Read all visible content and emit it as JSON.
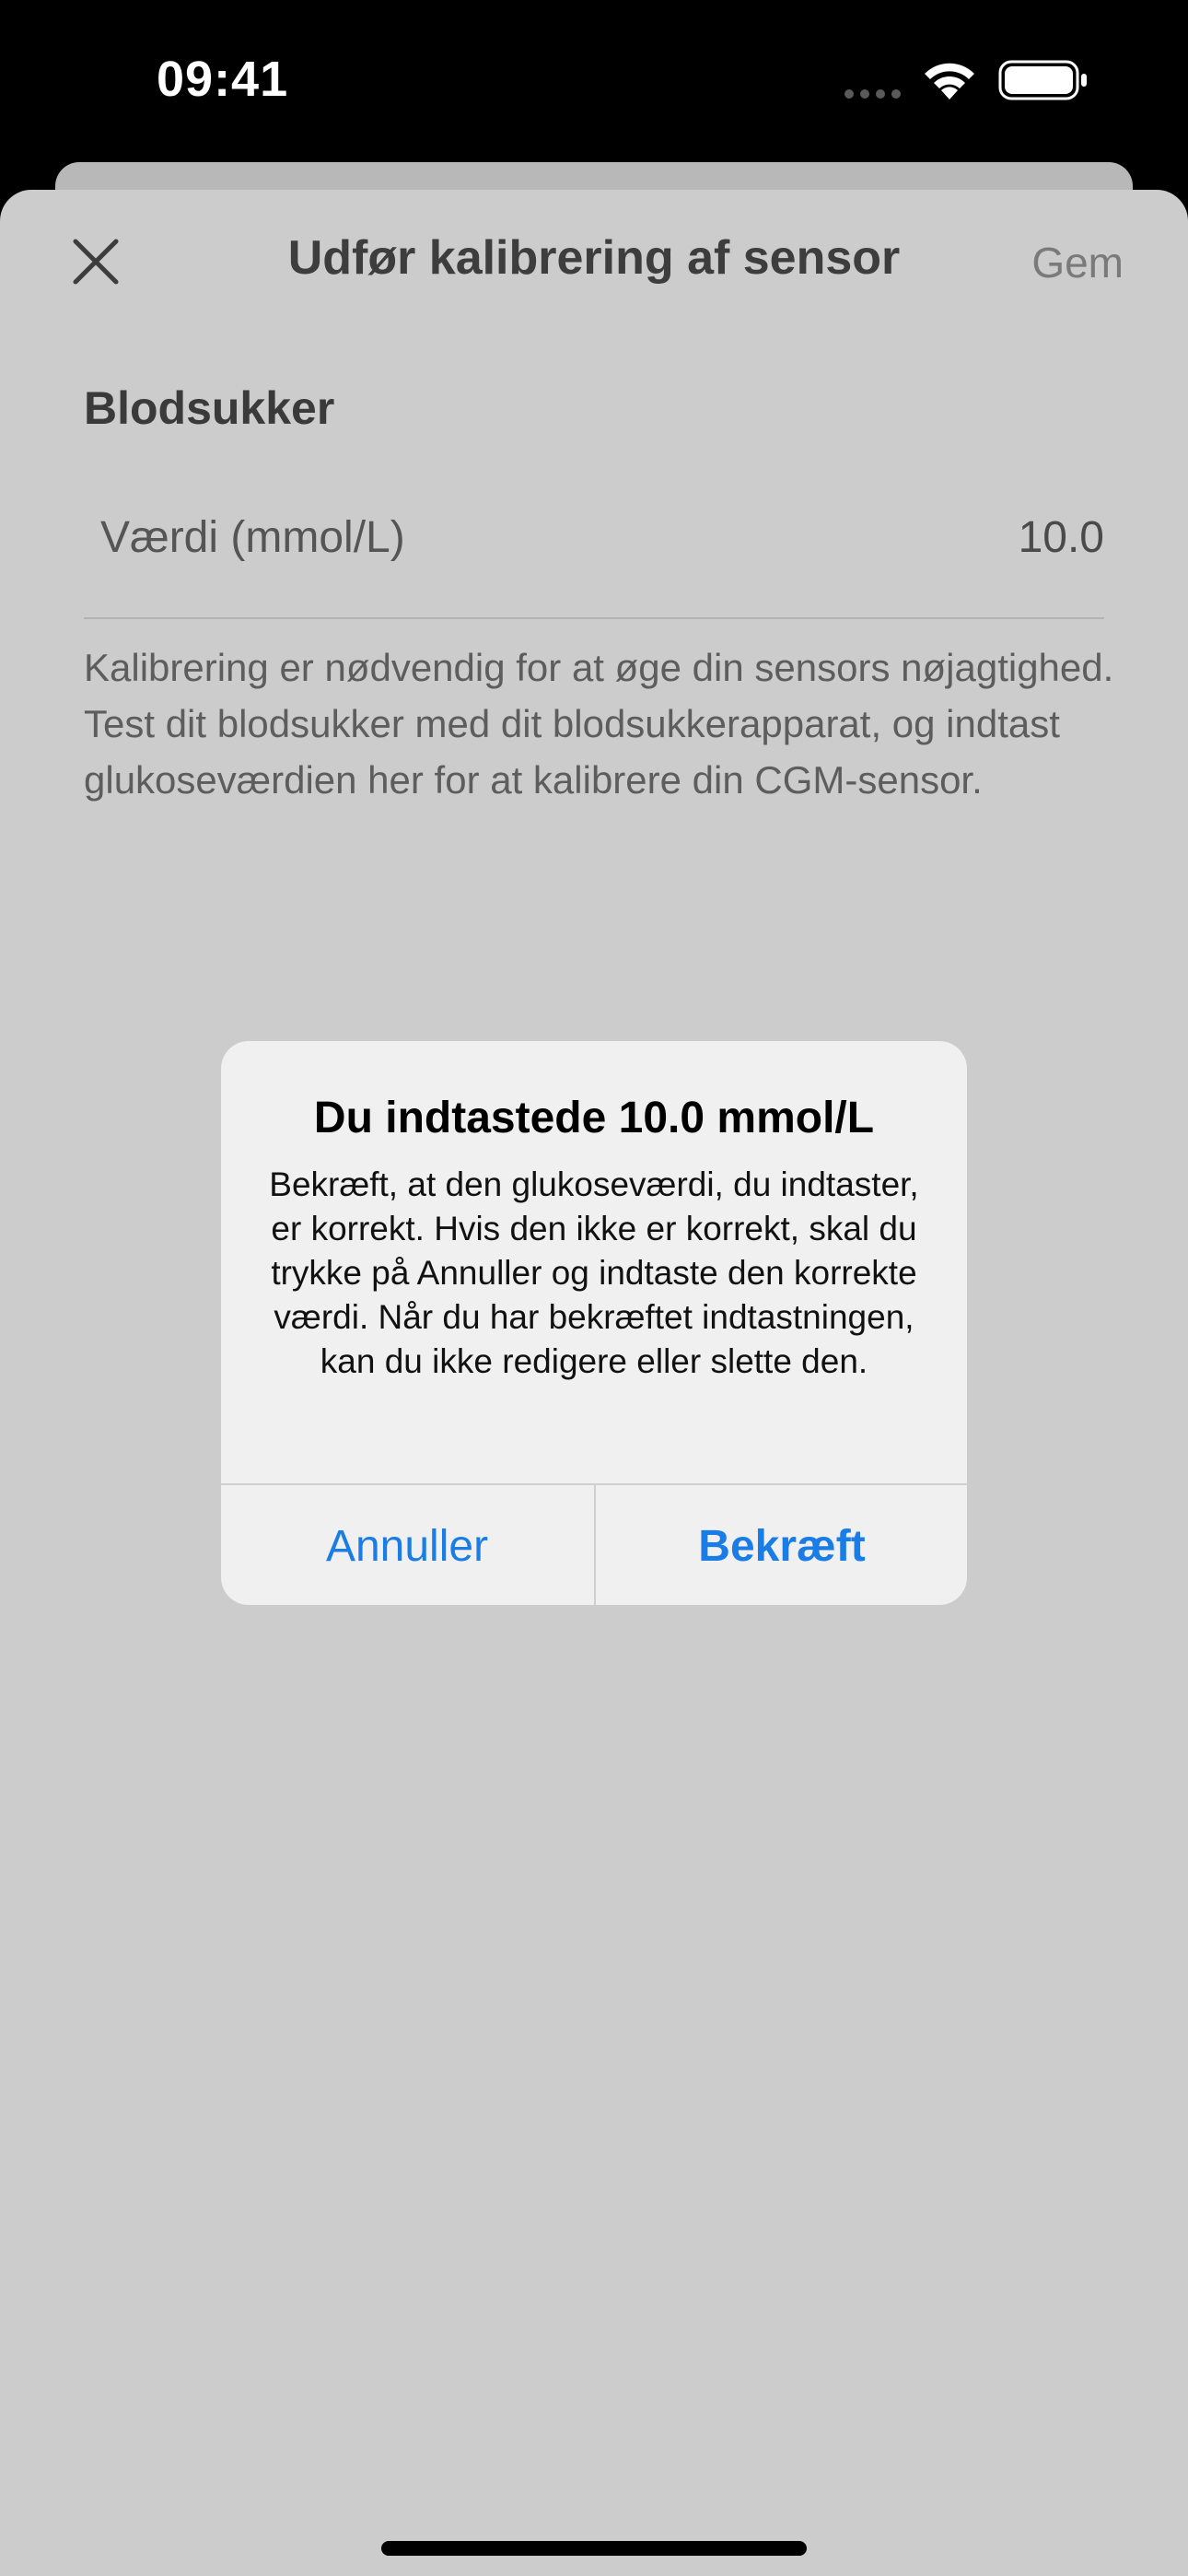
{
  "status_bar": {
    "time": "09:41"
  },
  "sheet": {
    "title": "Udfør kalibrering af sensor",
    "save_label": "Gem",
    "close_icon": "close-icon",
    "section_heading": "Blodsukker",
    "value_label": "Værdi (mmol/L)",
    "value": "10.0",
    "help_text": "Kalibrering er nødvendig for at øge din sensors nøjagtighed. Test dit blodsukker med dit blodsukkerapparat, og indtast glukoseværdien her for at kalibrere din CGM-sensor."
  },
  "alert": {
    "title": "Du indtastede 10.0 mmol/L",
    "message": "Bekræft, at den glukoseværdi, du indtaster, er korrekt. Hvis den ikke er korrekt, skal du trykke på Annuller og indtaste den korrekte værdi. Når du har bekræftet indtastningen, kan du ikke redigere eller slette den.",
    "cancel_label": "Annuller",
    "confirm_label": "Bekræft"
  },
  "colors": {
    "accent": "#1a7de6",
    "sheet_dimmed": "#cccccc",
    "alert_background": "#f0f0f0"
  }
}
